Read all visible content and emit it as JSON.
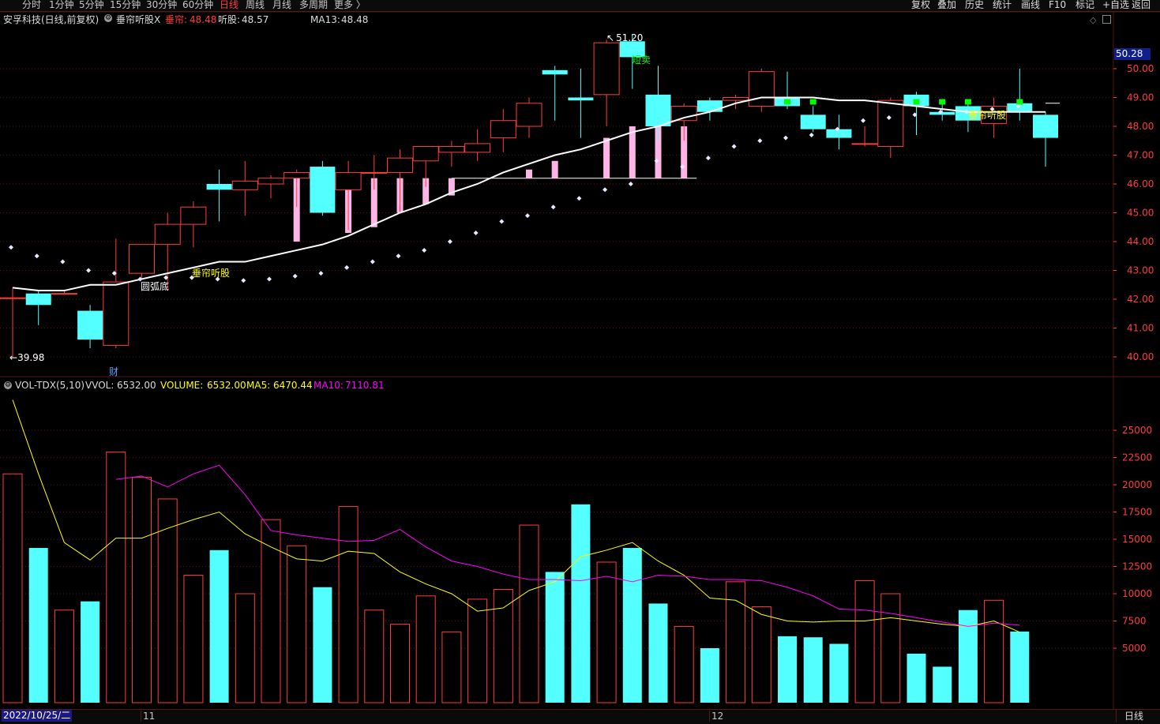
{
  "toolbar": {
    "periods": [
      "分时",
      "1分钟",
      "5分钟",
      "15分钟",
      "30分钟",
      "60分钟",
      "日线",
      "周线",
      "月线",
      "多周期",
      "更多 〉"
    ],
    "active_period": "日线",
    "right_buttons": [
      "复权",
      "叠加",
      "历史",
      "统计",
      "画线",
      "F10",
      "标记",
      "+自选",
      "返回"
    ]
  },
  "info": {
    "stock": "安孚科技(日线,前复权)",
    "indicator_icon": "gear-icon",
    "indicator": "垂帘听股X",
    "chuilian_label": "垂帘:",
    "chuilian_value": "48.48",
    "tinggu_label": "听股:",
    "tinggu_value": "48.57",
    "ma13_label": "MA13:",
    "ma13_value": "48.48"
  },
  "volume_info": {
    "name": "VOL-TDX(5,10)",
    "vvol_label": "VVOL:",
    "vvol_value": "6532.00",
    "volume_label": "VOLUME:",
    "volume_value": "6532.00",
    "ma5_label": "MA5:",
    "ma5_value": "6470.44",
    "ma10_label": "MA10:",
    "ma10_value": "7110.81"
  },
  "colors": {
    "up": "#ff3c3c",
    "down": "#54ffff",
    "ma13": "#ffffff",
    "ma5": "#ffff00",
    "ma10": "#ff00ff",
    "grid": "#5a1515",
    "axis": "#ff3c3c",
    "pink": "#ffb4e6",
    "green": "#00ff00"
  },
  "price_axis": {
    "ticks": [
      "50.00",
      "49.00",
      "48.00",
      "47.00",
      "46.00",
      "45.00",
      "44.00",
      "43.00",
      "42.00",
      "41.00",
      "40.00"
    ],
    "current_price": "50.28"
  },
  "volume_axis": {
    "ticks": [
      "25000",
      "22500",
      "20000",
      "17500",
      "15000",
      "12500",
      "10000",
      "7500",
      "5000"
    ]
  },
  "annotations": {
    "high": "51.20",
    "low": "39.98",
    "round_bottom": "圆弧底",
    "signal_left": "垂帘听股",
    "signal_right": "垂帘听股",
    "sell": "短卖",
    "finance": "财"
  },
  "x_axis": {
    "start_date": "2022/10/25/二",
    "month_labels": [
      "11",
      "12"
    ]
  },
  "bottom": {
    "period": "日线"
  },
  "chart_data": {
    "type": "candlestick",
    "candles": [
      {
        "o": 42.05,
        "h": 42.4,
        "l": 39.98,
        "c": 42.05
      },
      {
        "o": 42.2,
        "h": 42.3,
        "l": 41.1,
        "c": 41.8
      },
      {
        "o": 42.2,
        "h": 42.3,
        "l": 42.2,
        "c": 42.2
      },
      {
        "o": 41.6,
        "h": 41.8,
        "l": 40.3,
        "c": 40.6
      },
      {
        "o": 40.4,
        "h": 44.1,
        "l": 40.3,
        "c": 42.6
      },
      {
        "o": 42.9,
        "h": 43.7,
        "l": 42.7,
        "c": 43.9
      },
      {
        "o": 43.9,
        "h": 45.0,
        "l": 42.3,
        "c": 44.6
      },
      {
        "o": 44.6,
        "h": 45.4,
        "l": 43.8,
        "c": 45.2
      },
      {
        "o": 46.0,
        "h": 46.5,
        "l": 44.7,
        "c": 45.8
      },
      {
        "o": 45.8,
        "h": 46.8,
        "l": 44.9,
        "c": 46.1
      },
      {
        "o": 46.0,
        "h": 46.3,
        "l": 45.5,
        "c": 46.2
      },
      {
        "o": 46.2,
        "h": 46.5,
        "l": 45.2,
        "c": 46.4
      },
      {
        "o": 46.6,
        "h": 46.8,
        "l": 44.9,
        "c": 45.0
      },
      {
        "o": 45.8,
        "h": 46.8,
        "l": 44.4,
        "c": 46.4
      },
      {
        "o": 46.4,
        "h": 47.0,
        "l": 45.8,
        "c": 46.4
      },
      {
        "o": 46.4,
        "h": 47.2,
        "l": 45.0,
        "c": 46.9
      },
      {
        "o": 46.8,
        "h": 47.3,
        "l": 45.9,
        "c": 47.3
      },
      {
        "o": 47.1,
        "h": 47.5,
        "l": 46.6,
        "c": 47.3
      },
      {
        "o": 47.1,
        "h": 47.9,
        "l": 46.8,
        "c": 47.4
      },
      {
        "o": 47.6,
        "h": 48.6,
        "l": 47.1,
        "c": 48.2
      },
      {
        "o": 48.0,
        "h": 49.0,
        "l": 47.6,
        "c": 48.8
      },
      {
        "o": 49.95,
        "h": 50.1,
        "l": 48.2,
        "c": 49.8
      },
      {
        "o": 49.0,
        "h": 50.0,
        "l": 47.6,
        "c": 48.9
      },
      {
        "o": 49.1,
        "h": 51.0,
        "l": 48.0,
        "c": 50.9
      },
      {
        "o": 50.95,
        "h": 51.2,
        "l": 49.3,
        "c": 50.4
      },
      {
        "o": 49.1,
        "h": 50.1,
        "l": 47.5,
        "c": 48.0
      },
      {
        "o": 48.2,
        "h": 48.8,
        "l": 47.5,
        "c": 48.7
      },
      {
        "o": 48.9,
        "h": 49.0,
        "l": 48.2,
        "c": 48.5
      },
      {
        "o": 48.9,
        "h": 49.1,
        "l": 48.6,
        "c": 49.0
      },
      {
        "o": 48.7,
        "h": 50.0,
        "l": 48.5,
        "c": 49.9
      },
      {
        "o": 49.0,
        "h": 49.9,
        "l": 48.6,
        "c": 48.7
      },
      {
        "o": 48.4,
        "h": 48.7,
        "l": 47.8,
        "c": 47.9
      },
      {
        "o": 47.9,
        "h": 48.4,
        "l": 47.2,
        "c": 47.6
      },
      {
        "o": 47.4,
        "h": 48.0,
        "l": 47.3,
        "c": 47.4
      },
      {
        "o": 47.3,
        "h": 49.0,
        "l": 46.9,
        "c": 48.9
      },
      {
        "o": 49.1,
        "h": 49.2,
        "l": 47.7,
        "c": 48.7
      },
      {
        "o": 48.5,
        "h": 48.9,
        "l": 48.2,
        "c": 48.4
      },
      {
        "o": 48.7,
        "h": 48.9,
        "l": 47.8,
        "c": 48.2
      },
      {
        "o": 48.1,
        "h": 49.0,
        "l": 47.6,
        "c": 48.7
      },
      {
        "o": 48.8,
        "h": 50.0,
        "l": 48.2,
        "c": 48.5
      },
      {
        "o": 48.4,
        "h": 48.5,
        "l": 46.6,
        "c": 47.6
      }
    ],
    "ma13": [
      42.4,
      42.3,
      42.3,
      42.5,
      42.5,
      42.7,
      42.9,
      43.1,
      43.3,
      43.3,
      43.5,
      43.7,
      43.9,
      44.2,
      44.6,
      45.0,
      45.3,
      45.7,
      46.0,
      46.4,
      46.7,
      47.0,
      47.2,
      47.5,
      47.8,
      48.0,
      48.3,
      48.5,
      48.8,
      49.0,
      49.0,
      49.0,
      48.9,
      48.9,
      48.8,
      48.7,
      48.6,
      48.5,
      48.5,
      48.5,
      48.5
    ],
    "volume": [
      21000,
      14200,
      8500,
      9300,
      23000,
      20700,
      18700,
      11700,
      14000,
      10000,
      16800,
      14400,
      10600,
      18000,
      8500,
      7200,
      9800,
      6500,
      9500,
      10400,
      16300,
      12000,
      18200,
      12900,
      14200,
      9100,
      7000,
      5000,
      11100,
      8800,
      6100,
      6000,
      5400,
      11200,
      10000,
      4500,
      3300,
      8500,
      9400,
      6532
    ],
    "ma5": [
      27800,
      21000,
      14700,
      13100,
      15100,
      15100,
      16000,
      16800,
      17500,
      15500,
      14300,
      13200,
      13000,
      13900,
      13700,
      12000,
      10900,
      10000,
      8400,
      8700,
      10300,
      11100,
      13400,
      14000,
      14700,
      13000,
      11700,
      9600,
      9400,
      8100,
      7500,
      7400,
      7500,
      7500,
      7800,
      7500,
      7200,
      7000,
      7500,
      6470
    ],
    "ma10": [
      null,
      null,
      null,
      null,
      20500,
      20800,
      19800,
      21000,
      21800,
      19100,
      15800,
      15400,
      15100,
      14800,
      14900,
      15900,
      14300,
      13000,
      12500,
      11800,
      11300,
      11300,
      11200,
      11600,
      11100,
      11700,
      11600,
      11300,
      11300,
      11200,
      10600,
      9800,
      8600,
      8500,
      8200,
      7800,
      7400,
      7000,
      7300,
      7110
    ]
  }
}
